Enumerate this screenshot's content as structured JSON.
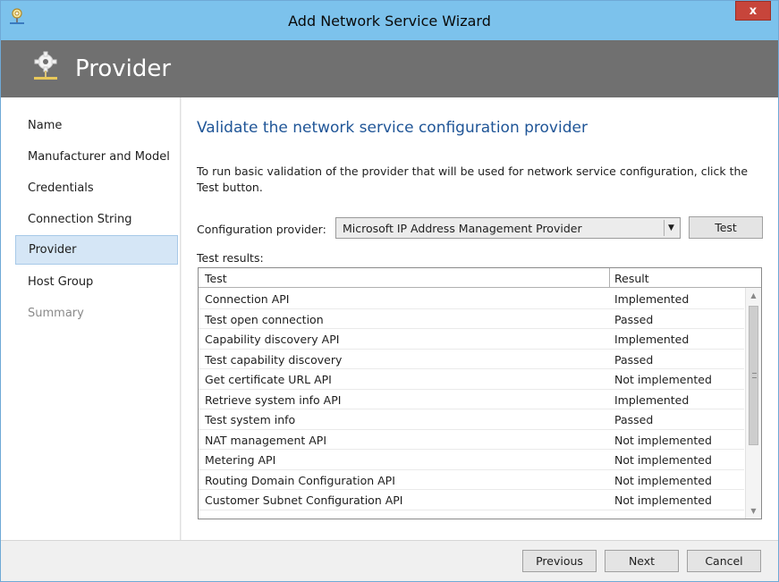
{
  "window": {
    "title": "Add Network Service Wizard",
    "close_label": "x"
  },
  "banner": {
    "title": "Provider"
  },
  "sidebar": {
    "items": [
      {
        "label": "Name"
      },
      {
        "label": "Manufacturer and Model"
      },
      {
        "label": "Credentials"
      },
      {
        "label": "Connection String"
      },
      {
        "label": "Provider"
      },
      {
        "label": "Host Group"
      },
      {
        "label": "Summary"
      }
    ]
  },
  "main": {
    "heading": "Validate the network service configuration provider",
    "description": "To run basic validation of the provider that will be used for network service configuration, click the Test button.",
    "config_label": "Configuration provider:",
    "config_value": "Microsoft IP Address Management Provider",
    "test_button": "Test",
    "results_label": "Test results:",
    "table": {
      "columns": [
        "Test",
        "Result"
      ],
      "rows": [
        {
          "test": "Connection API",
          "result": "Implemented"
        },
        {
          "test": "Test open connection",
          "result": "Passed"
        },
        {
          "test": "Capability discovery API",
          "result": "Implemented"
        },
        {
          "test": "Test capability discovery",
          "result": "Passed"
        },
        {
          "test": "Get certificate URL API",
          "result": "Not implemented"
        },
        {
          "test": "Retrieve system info API",
          "result": "Implemented"
        },
        {
          "test": "Test system info",
          "result": "Passed"
        },
        {
          "test": "NAT management API",
          "result": "Not implemented"
        },
        {
          "test": "Metering API",
          "result": "Not implemented"
        },
        {
          "test": "Routing Domain Configuration API",
          "result": "Not implemented"
        },
        {
          "test": "Customer Subnet Configuration API",
          "result": "Not implemented"
        }
      ]
    }
  },
  "footer": {
    "previous": "Previous",
    "next": "Next",
    "cancel": "Cancel"
  },
  "colors": {
    "titlebar": "#7cc2ec",
    "banner": "#707070",
    "heading": "#1f5597",
    "nav_active": "#d5e6f6",
    "close": "#c7453b"
  }
}
